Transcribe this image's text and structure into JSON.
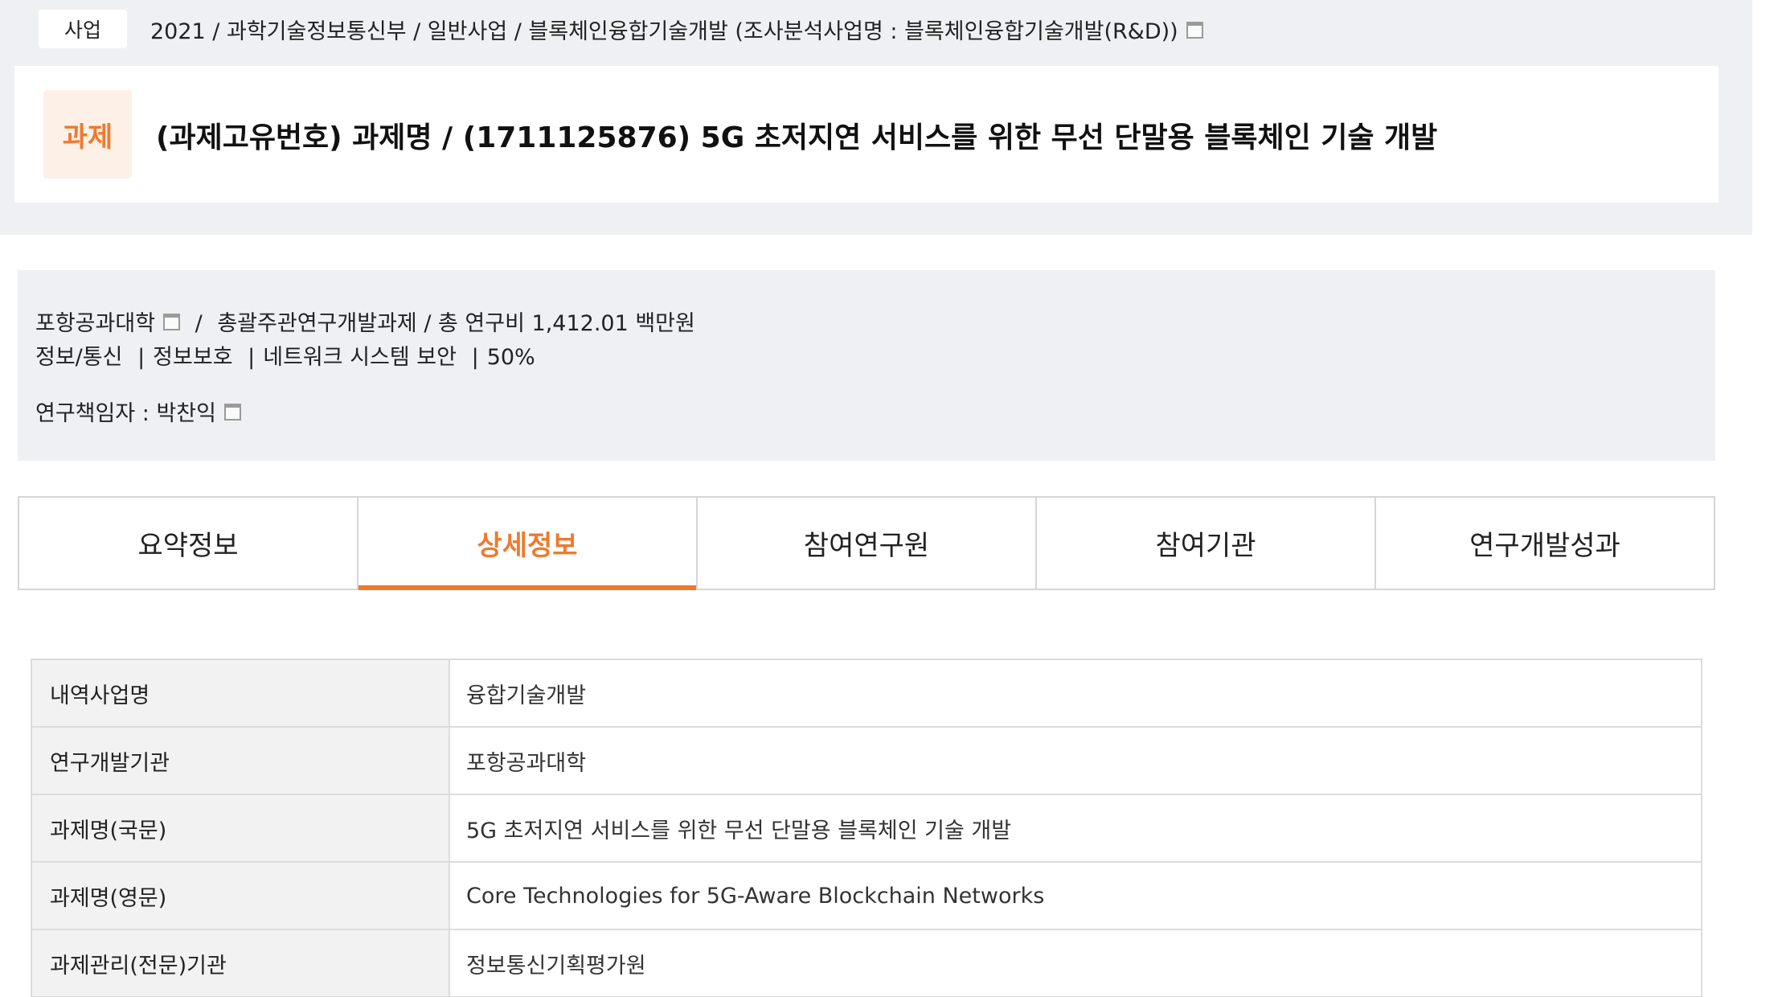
{
  "business": {
    "badge": "사업",
    "path": "2021 / 과학기술정보통신부 / 일반사업 / 블록체인융합기술개발 (조사분석사업명 : 블록체인융합기술개발(R&D))"
  },
  "task": {
    "badge": "과제",
    "title": "(과제고유번호) 과제명 / (1711125876) 5G 초저지연 서비스를 위한 무선 단말용 블록체인 기술 개발"
  },
  "info": {
    "institution": "포항공과대학",
    "slash": "/",
    "project_type": "총괄주관연구개발과제 / 총 연구비 1,412.01 백만원",
    "category1": "정보/통신",
    "category2": "정보보호",
    "category3": "네트워크 시스템 보안",
    "ratio": "50%",
    "separator": "|",
    "pi_label": "연구책임자 : 박찬익"
  },
  "tabs": [
    {
      "label": "요약정보",
      "active": false
    },
    {
      "label": "상세정보",
      "active": true
    },
    {
      "label": "참여연구원",
      "active": false
    },
    {
      "label": "참여기관",
      "active": false
    },
    {
      "label": "연구개발성과",
      "active": false
    }
  ],
  "details": [
    {
      "label": "내역사업명",
      "value": "융합기술개발"
    },
    {
      "label": "연구개발기관",
      "value": "포항공과대학"
    },
    {
      "label": "과제명(국문)",
      "value": "5G 초저지연 서비스를 위한 무선 단말용 블록체인 기술 개발"
    },
    {
      "label": "과제명(영문)",
      "value": "Core Technologies for 5G-Aware Blockchain Networks"
    },
    {
      "label": "과제관리(전문)기관",
      "value": "정보통신기획평가원"
    }
  ],
  "colors": {
    "accent": "#ee7a2f",
    "band": "#eef0f4",
    "label_bg": "#f2f2f2"
  },
  "icons": {
    "window": "new-window-icon"
  }
}
